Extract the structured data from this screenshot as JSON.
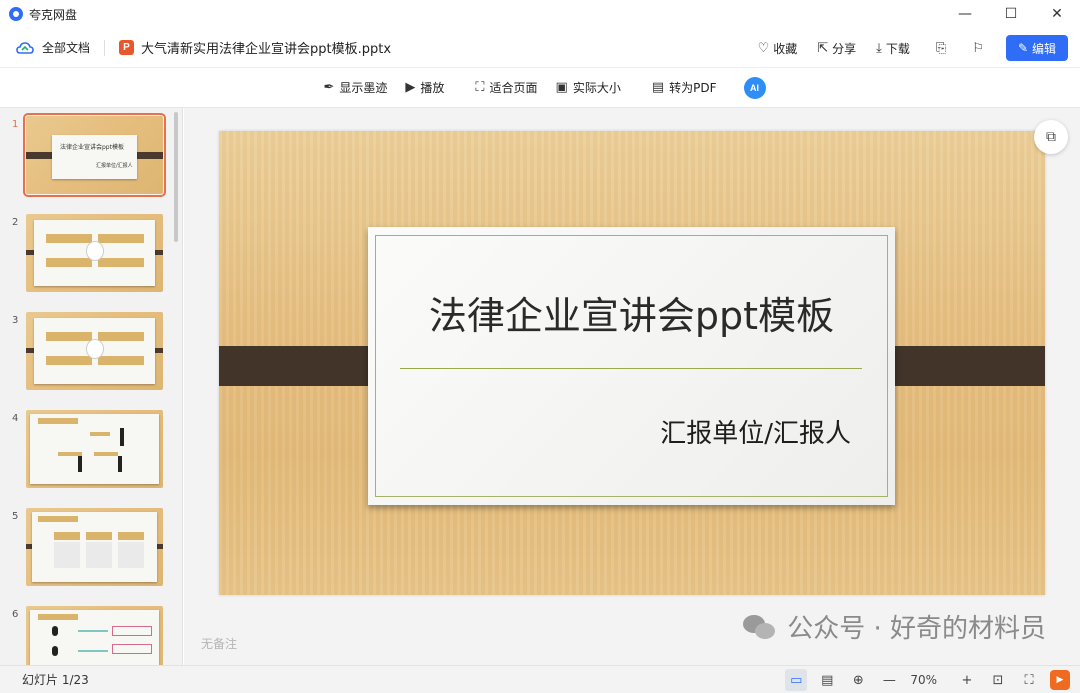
{
  "app": {
    "title": "夸克网盘"
  },
  "window": {
    "minimize": "—",
    "maximize": "☐",
    "close": "✕"
  },
  "toolbar": {
    "all_docs": "全部文档",
    "file_type_letter": "P",
    "file_name": "大气清新实用法律企业宣讲会ppt模板.pptx",
    "favorite": "收藏",
    "share": "分享",
    "download": "下载",
    "edit": "编辑"
  },
  "viewer": {
    "show_ink": "显示墨迹",
    "play": "播放",
    "fit_page": "适合页面",
    "actual_size": "实际大小",
    "to_pdf": "转为PDF",
    "ai": "AI"
  },
  "sidebar": {
    "thumbnails": [
      {
        "num": "1"
      },
      {
        "num": "2"
      },
      {
        "num": "3"
      },
      {
        "num": "4"
      },
      {
        "num": "5"
      },
      {
        "num": "6"
      }
    ],
    "thumb1_title": "法律企业宣讲会ppt模板",
    "thumb1_sub": "汇报单位/汇报人"
  },
  "slide": {
    "title": "法律企业宣讲会ppt模板",
    "subtitle": "汇报单位/汇报人"
  },
  "notes": "无备注",
  "watermark": "公众号 · 好奇的材料员",
  "status": {
    "slide_count": "幻灯片 1/23",
    "zoom": "70%"
  },
  "colors": {
    "accent": "#2f6df6",
    "file_icon": "#e8572b",
    "active_thumb_border": "#e8704a",
    "play": "#ef6b21",
    "slide_band": "#423429"
  }
}
